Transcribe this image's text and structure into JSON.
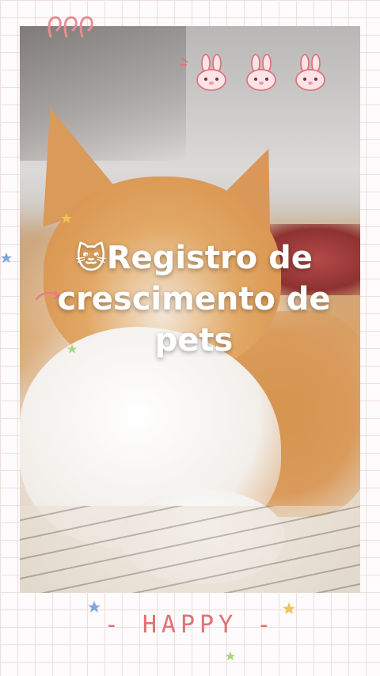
{
  "title": {
    "emoji": "🐱",
    "text": "Registro de crescimento de pets"
  },
  "footer": {
    "word": "- HAPPY -"
  },
  "decorations": {
    "bunny_glyph": "🐰",
    "bunny_count": 3,
    "pink_swirl_icon": "pink-swirl-icon",
    "stars": [
      "blue-star-icon",
      "yellow-star-icon",
      "green-star-icon"
    ]
  },
  "colors": {
    "accent_pink": "#e46f73",
    "grid_line": "#f1dede",
    "background": "#fdfbfb"
  }
}
